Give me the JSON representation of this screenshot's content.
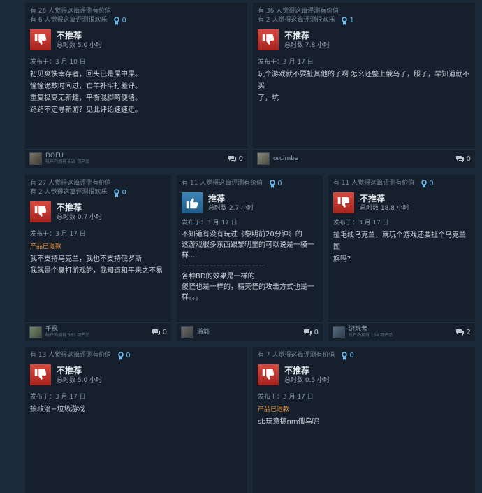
{
  "colors": {
    "page_background": "#1b2838",
    "card_background": "#16202d",
    "not_recommended_thumb": "#c9302c",
    "recommended_thumb": "#2f77a8",
    "award_blue": "#66c0f4",
    "refund_orange": "#e78f3c"
  },
  "icons": {
    "thumb_down": "thumbs-down-icon",
    "thumb_up": "thumbs-up-icon",
    "award": "award-ribbon-icon",
    "comment": "comment-bubble-icon"
  },
  "reviews": [
    {
      "helpful": "有 26 人觉得这篇评测有价值",
      "funny": "有 6 人觉得这篇评测很欢乐",
      "awards": "0",
      "verdict": "不推荐",
      "hours": "总时数 5.0 小时",
      "posted": "发布于：3 月 10 日",
      "refund": "",
      "lines": [
        "初见爽快幸存者，回头已是屎中屎。",
        "憧憧诡数时间过，亡羊补牢打差评。",
        "重复极高无新趣，平衡混脚畸便墙。",
        "路路不定寻新游？见此评论速速走。"
      ],
      "user": "DOFU",
      "owned": "帐户内拥有 655 项产品",
      "comments": "0"
    },
    {
      "helpful": "有 36 人觉得这篇评测有价值",
      "funny": "有 2 人觉得这篇评测很欢乐",
      "awards": "1",
      "verdict": "不推荐",
      "hours": "总时数 7.8 小时",
      "posted": "发布于：3 月 17 日",
      "refund": "",
      "lines": [
        "玩个游戏就不要扯其他的了啊 怎么还整上俄乌了，服了，早知道就不买",
        "了，坑"
      ],
      "user": "orcimba",
      "owned": "",
      "comments": "0"
    },
    {
      "helpful": "有 27 人觉得这篇评测有价值",
      "funny": "有 2 人觉得这篇评测很欢乐",
      "awards": "0",
      "verdict": "不推荐",
      "hours": "总时数 0.7 小时",
      "posted": "发布于：3 月 17 日",
      "refund": "产品已退款",
      "lines": [
        "",
        "我不支持乌克兰，我也不支持俄罗斯",
        "我就是个臭打游戏的，我知道和平来之不易"
      ],
      "user": "千枫",
      "owned": "帐户内拥有 563 项产品",
      "comments": "0"
    },
    {
      "helpful": "有 11 人觉得这篇评测有价值",
      "funny": "",
      "awards": "0",
      "verdict": "推荐",
      "hours": "总时数 2.7 小时",
      "posted": "发布于：3 月 17 日",
      "refund": "",
      "lines": [
        "不知道有没有玩过《黎明前20分钟》的",
        "这游戏很多东西跟黎明里的可以说是一模一",
        "样....",
        "————————————",
        "各种BD的效果是一样的",
        "傻怪也是一样的，精英怪的攻击方式也是一",
        "样。。。"
      ],
      "user": "滥觞",
      "owned": "",
      "comments": "0"
    },
    {
      "helpful": "有 11 人觉得这篇评测有价值",
      "funny": "",
      "awards": "0",
      "verdict": "不推荐",
      "hours": "总时数 18.8 小时",
      "posted": "发布于：3 月 17 日",
      "refund": "",
      "lines": [
        "扯毛线乌克兰，就玩个游戏还要扯个乌克兰国",
        "旗吗?"
      ],
      "user": "游玩者",
      "owned": "帐户内拥有 164 项产品",
      "comments": "2"
    },
    {
      "helpful": "有 13 人觉得这篇评测有价值",
      "funny": "",
      "awards": "0",
      "verdict": "不推荐",
      "hours": "总时数 5.0 小时",
      "posted": "发布于：3 月 17 日",
      "refund": "",
      "lines": [
        "搞政治=垃圾游戏"
      ],
      "user": "",
      "owned": "",
      "comments": ""
    },
    {
      "helpful": "有 7 人觉得这篇评测有价值",
      "funny": "",
      "awards": "0",
      "verdict": "不推荐",
      "hours": "总时数 0.5 小时",
      "posted": "发布于：3 月 17 日",
      "refund": "产品已退款",
      "lines": [
        "",
        "sb玩意搞nm俄乌呢"
      ],
      "user": "",
      "owned": "",
      "comments": ""
    }
  ]
}
